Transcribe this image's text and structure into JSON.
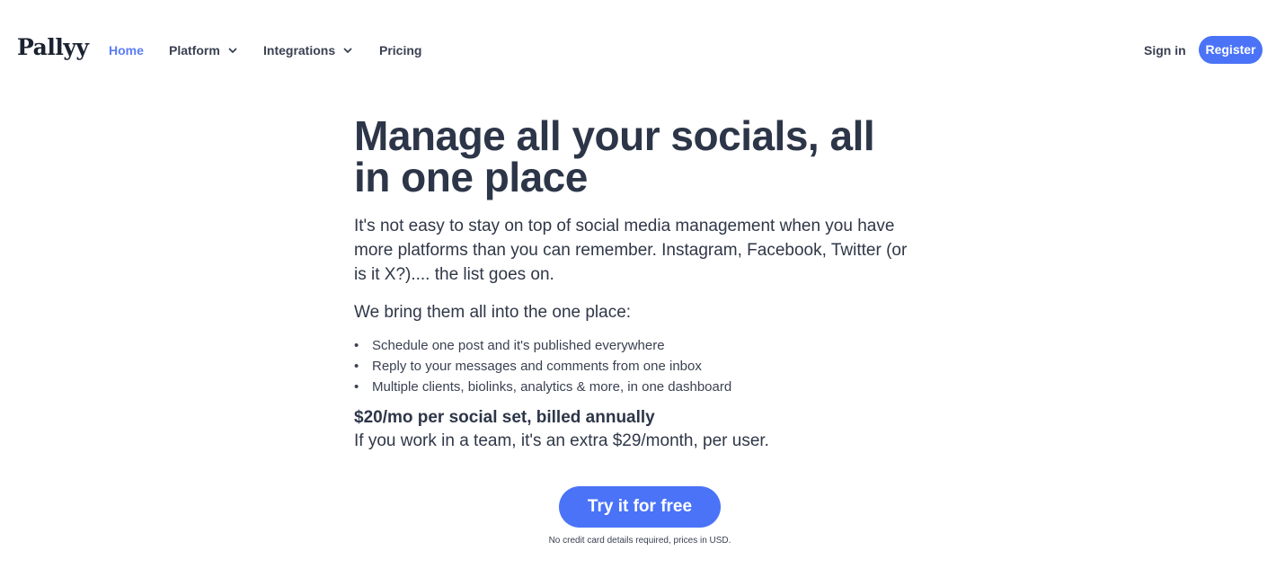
{
  "brand": {
    "logo_text": "Pallyy"
  },
  "nav": {
    "items": [
      {
        "label": "Home",
        "active": true,
        "has_dropdown": false
      },
      {
        "label": "Platform",
        "active": false,
        "has_dropdown": true
      },
      {
        "label": "Integrations",
        "active": false,
        "has_dropdown": true
      },
      {
        "label": "Pricing",
        "active": false,
        "has_dropdown": false
      }
    ],
    "sign_in": "Sign in",
    "register": "Register"
  },
  "hero": {
    "headline": "Manage all your socials, all in one place",
    "intro": "It's not easy to stay on top of social media management when you have more platforms than you can remember. Instagram, Facebook, Twitter (or is it X?).... the list goes on.",
    "bring_line": "We bring them all into the one place:",
    "features": [
      "Schedule one post and it's published everywhere",
      "Reply to your messages and comments from one inbox",
      "Multiple clients, biolinks, analytics & more, in one dashboard"
    ],
    "price_line": "$20/mo per social set, billed annually",
    "team_line": "If you work in a team, it's an extra $29/month, per user.",
    "cta_label": "Try it for free",
    "disclaimer": "No credit card details required, prices in USD."
  },
  "colors": {
    "accent": "#4a73f7",
    "active_link": "#5b7cf5",
    "text": "#2d3648",
    "background": "#ffffff"
  },
  "icons": {
    "dropdown": "chevron-down-icon"
  }
}
